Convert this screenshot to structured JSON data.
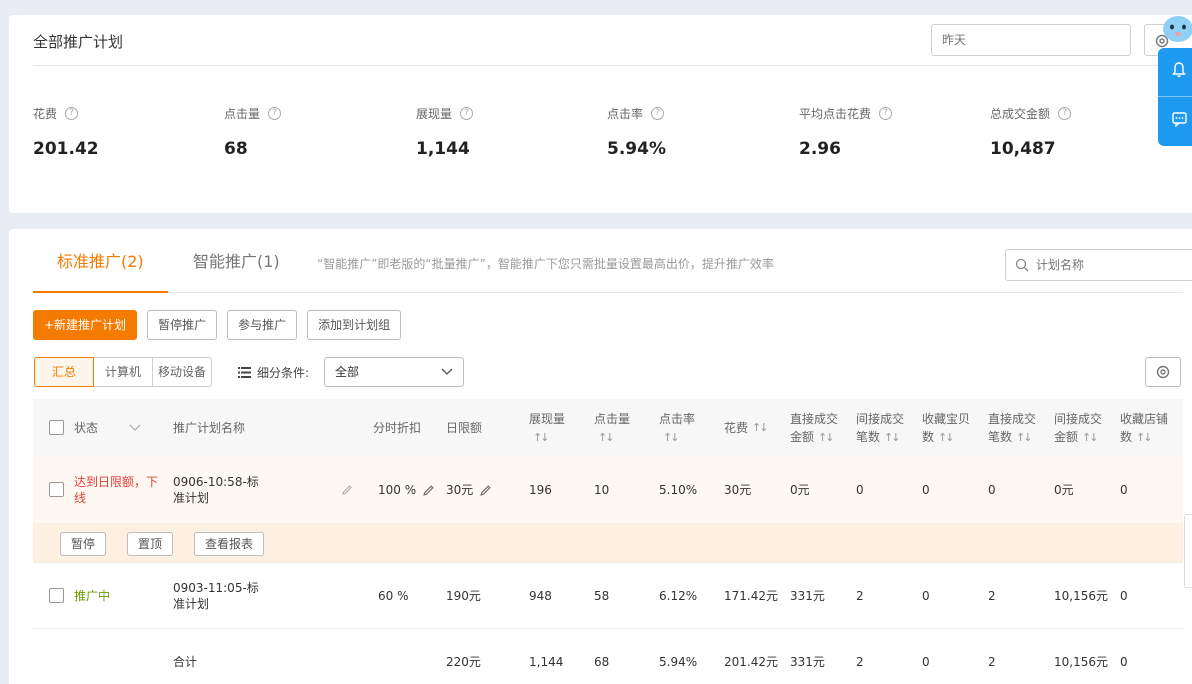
{
  "overview": {
    "title": "全部推广计划",
    "date_placeholder": "昨天",
    "metrics": [
      {
        "label": "花费",
        "value": "201.42"
      },
      {
        "label": "点击量",
        "value": "68"
      },
      {
        "label": "展现量",
        "value": "1,144"
      },
      {
        "label": "点击率",
        "value": "5.94%"
      },
      {
        "label": "平均点击花费",
        "value": "2.96"
      },
      {
        "label": "总成交金额",
        "value": "10,487"
      }
    ]
  },
  "tabs": [
    {
      "label": "标准推广(2)"
    },
    {
      "label": "智能推广(1)"
    }
  ],
  "tab_note": "“智能推广”即老版的“批量推广”，智能推广下您只需批量设置最高出价，提升推广效率",
  "search": {
    "placeholder": "计划名称"
  },
  "actions": {
    "new_plan": "+新建推广计划",
    "pause": "暂停推广",
    "join": "参与推广",
    "add_group": "添加到计划组"
  },
  "filters": {
    "segments": [
      "汇总",
      "计算机",
      "移动设备"
    ],
    "condition_label": "细分条件:",
    "condition_value": "全部"
  },
  "table": {
    "headers": {
      "status": "状态",
      "name": "推广计划名称",
      "discount": "分时折扣",
      "limit": "日限额",
      "impressions": "展现量",
      "clicks": "点击量",
      "ctr": "点击率",
      "cost": "花费",
      "direct_amount": "直接成交金额",
      "indirect_count": "间接成交笔数",
      "fav_item": "收藏宝贝数",
      "direct_count": "直接成交笔数",
      "indirect_amount": "间接成交金额",
      "fav_shop": "收藏店铺数"
    },
    "rows": [
      {
        "status": "达到日限额，下线",
        "name": "0906-10:58-标准计划",
        "discount": "100 %",
        "limit": "30元",
        "impressions": "196",
        "clicks": "10",
        "ctr": "5.10%",
        "cost": "30元",
        "direct_amount": "0元",
        "indirect_count": "0",
        "fav_item": "0",
        "direct_count": "0",
        "indirect_amount": "0元",
        "fav_shop": "0"
      },
      {
        "status": "推广中",
        "name": "0903-11:05-标准计划",
        "discount": "60 %",
        "limit": "190元",
        "impressions": "948",
        "clicks": "58",
        "ctr": "6.12%",
        "cost": "171.42元",
        "direct_amount": "331元",
        "indirect_count": "2",
        "fav_item": "0",
        "direct_count": "2",
        "indirect_amount": "10,156元",
        "fav_shop": "0"
      }
    ],
    "row_ops": [
      "暂停",
      "置顶",
      "查看报表"
    ],
    "total": {
      "label": "合计",
      "limit": "220元",
      "impressions": "1,144",
      "clicks": "68",
      "ctr": "5.94%",
      "cost": "201.42元",
      "direct_amount": "331元",
      "indirect_count": "2",
      "fav_item": "0",
      "direct_count": "2",
      "indirect_amount": "10,156元",
      "fav_shop": "0"
    }
  },
  "colors": {
    "accent": "#f57a00",
    "status_red": "#e0413a",
    "status_green": "#6a9a00",
    "float_blue": "#1e9bf0"
  }
}
